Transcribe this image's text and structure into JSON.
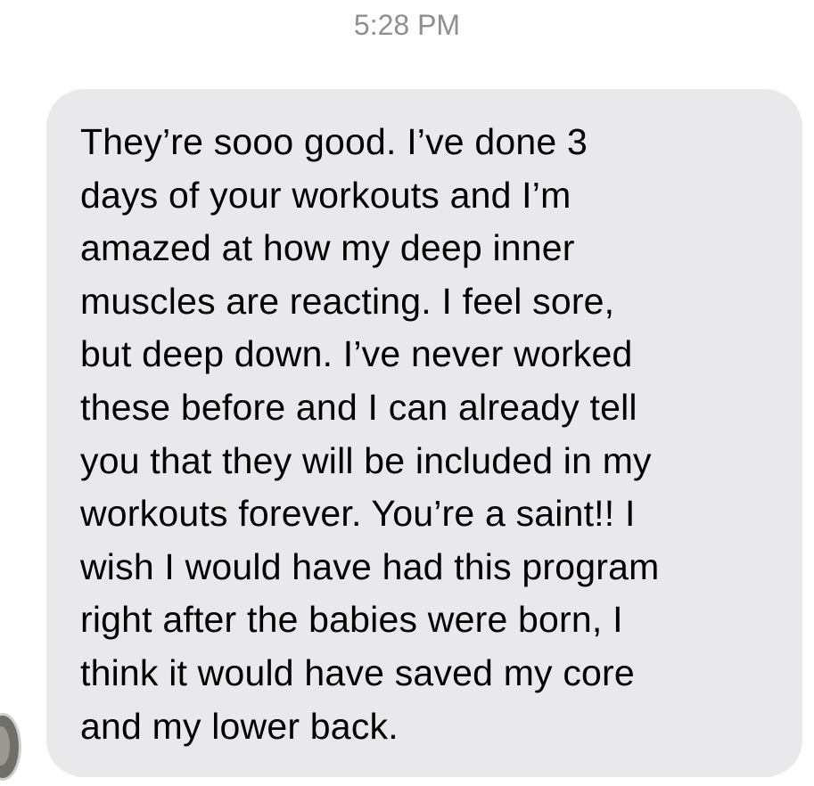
{
  "conversation": {
    "timestamp": "5:28 PM",
    "message": {
      "lines": [
        "They’re sooo good. I’ve done 3",
        "days of your workouts and I’m",
        "amazed at how my deep inner",
        "muscles are reacting. I feel sore,",
        "but deep down. I’ve never worked",
        "these before and I can already tell",
        "you that they will be included in my",
        "workouts forever. You’re a saint!! I",
        "wish I would have had this program",
        "right after the babies were born, I",
        "think it would have saved my core",
        "and my lower back."
      ]
    }
  },
  "colors": {
    "bubble": "#e9e9eb",
    "timestamp": "#8e8e93",
    "text": "#000000"
  },
  "icons": {
    "avatar": "sender-avatar"
  }
}
